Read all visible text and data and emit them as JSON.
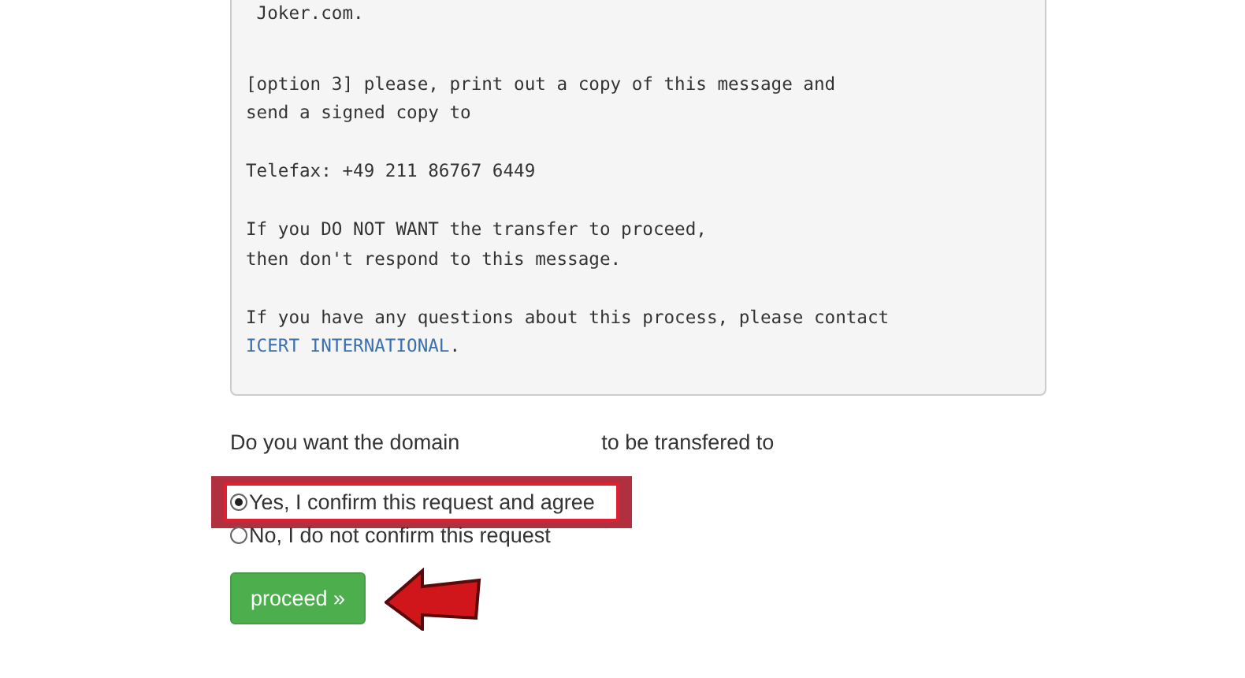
{
  "message": {
    "paragraphs": [
      {
        "lines": [
          " Joker.com."
        ]
      },
      {
        "lines": [
          "[option 3] please, print out a copy of this message and",
          "send a signed copy to"
        ]
      },
      {
        "lines": [
          "Telefax: +49 211 86767 6449"
        ]
      },
      {
        "lines": [
          "If you DO NOT WANT the transfer to proceed,",
          "then don't respond to this message."
        ]
      },
      {
        "lines": [
          "If you have any questions about this process, please contact"
        ],
        "link": "ICERT INTERNATIONAL",
        "after_link": "."
      }
    ]
  },
  "question": {
    "before": "Do you want the domain",
    "after": "to be transfered to"
  },
  "options": [
    {
      "label": "Yes, I confirm this request and agree",
      "selected": true,
      "highlighted": true
    },
    {
      "label": "No, I do not confirm this request",
      "selected": false,
      "highlighted": false
    }
  ],
  "button": {
    "label": "proceed »"
  }
}
